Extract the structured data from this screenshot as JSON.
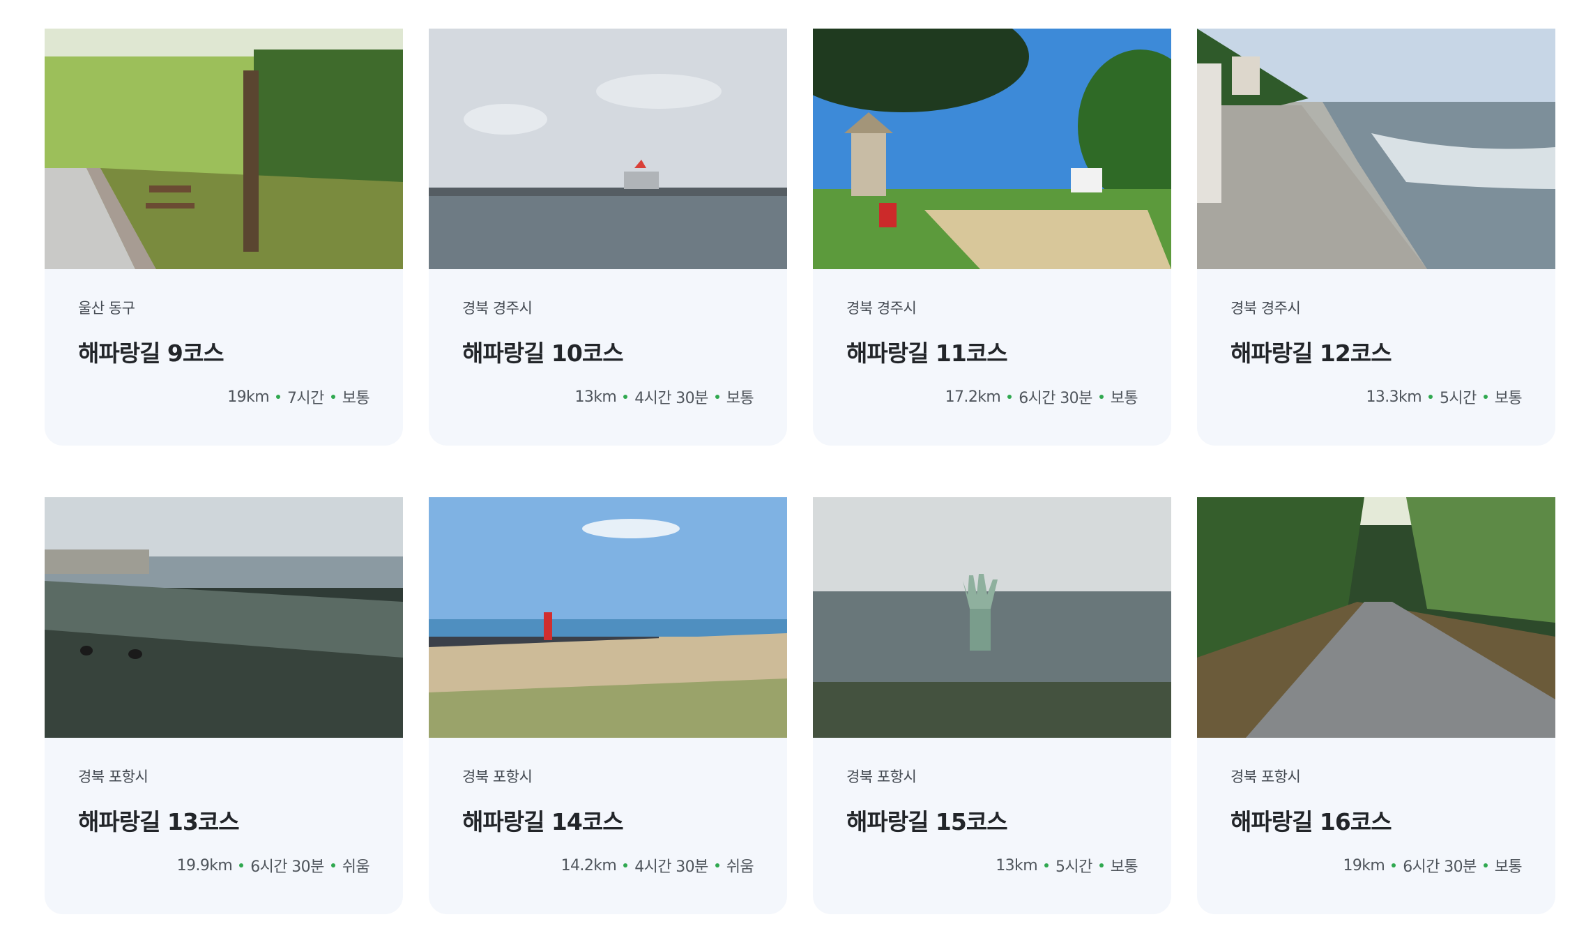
{
  "colors": {
    "card_bg": "#f4f7fc",
    "dot_accent": "#2fa84f"
  },
  "courses": [
    {
      "region": "울산 동구",
      "title": "해파랑길 9코스",
      "distance": "19km",
      "duration": "7시간",
      "difficulty": "보통",
      "photo": "park-bench-path"
    },
    {
      "region": "경북 경주시",
      "title": "해파랑길 10코스",
      "distance": "13km",
      "duration": "4시간 30분",
      "difficulty": "보통",
      "photo": "harbor-cloudy"
    },
    {
      "region": "경북 경주시",
      "title": "해파랑길 11코스",
      "distance": "17.2km",
      "duration": "6시간 30분",
      "difficulty": "보통",
      "photo": "stone-pagoda-park"
    },
    {
      "region": "경북 경주시",
      "title": "해파랑길 12코스",
      "distance": "13.3km",
      "duration": "5시간",
      "difficulty": "보통",
      "photo": "seawall-waves"
    },
    {
      "region": "경북 포항시",
      "title": "해파랑길 13코스",
      "distance": "19.9km",
      "duration": "6시간 30분",
      "difficulty": "쉬움",
      "photo": "rocky-shore"
    },
    {
      "region": "경북 포항시",
      "title": "해파랑길 14코스",
      "distance": "14.2km",
      "duration": "4시간 30분",
      "difficulty": "쉬움",
      "photo": "beach-lighthouse"
    },
    {
      "region": "경북 포항시",
      "title": "해파랑길 15코스",
      "distance": "13km",
      "duration": "5시간",
      "difficulty": "보통",
      "photo": "hand-sculpture-sea"
    },
    {
      "region": "경북 포항시",
      "title": "해파랑길 16코스",
      "distance": "19km",
      "duration": "6시간 30분",
      "difficulty": "보통",
      "photo": "forest-road"
    }
  ]
}
